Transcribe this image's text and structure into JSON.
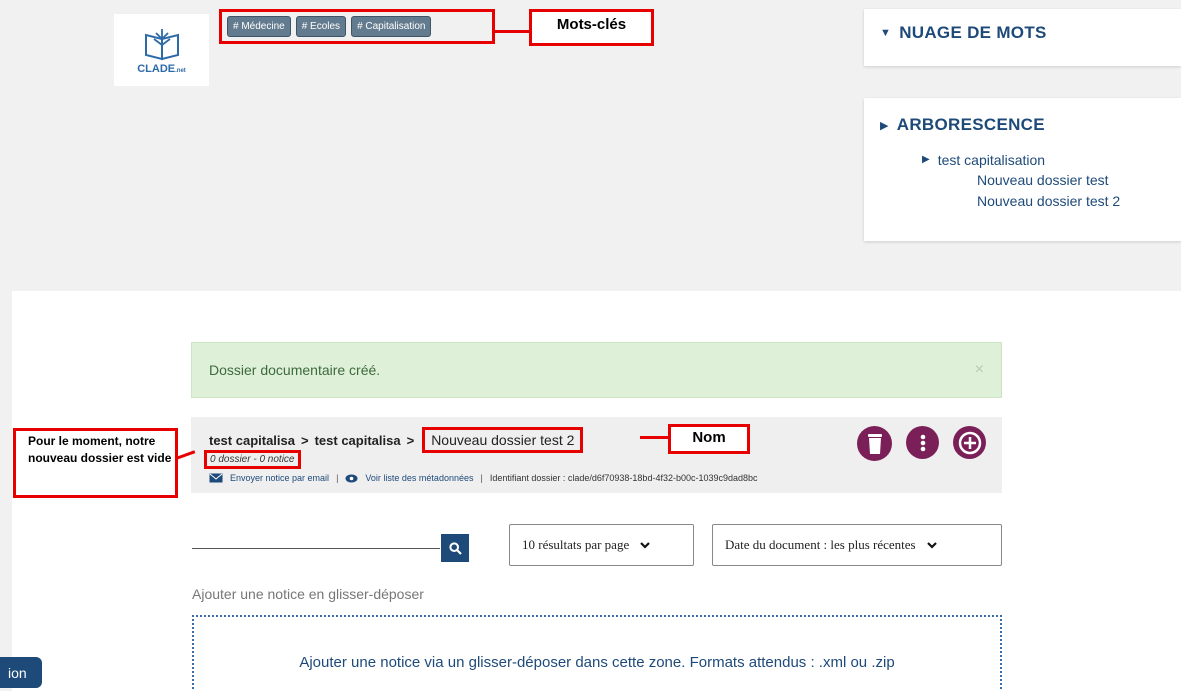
{
  "logo": {
    "name": "CLADE",
    "suffix": ".net"
  },
  "keywords": {
    "tags": [
      "# Médecine",
      "# Ecoles",
      "# Capitalisation"
    ],
    "annotation": "Mots-clés"
  },
  "word_cloud": {
    "title": "NUAGE DE MOTS"
  },
  "tree_panel": {
    "title": "ARBORESCENCE",
    "root": "test capitalisation",
    "children": [
      "Nouveau dossier test",
      "Nouveau dossier test 2"
    ]
  },
  "alert": {
    "message": "Dossier documentaire créé.",
    "close": "×"
  },
  "breadcrumb": {
    "items": [
      "test capitalisa",
      "test capitalisa"
    ],
    "separator": ">",
    "current": "Nouveau dossier test 2"
  },
  "folder": {
    "counts": "0 dossier - 0 notice",
    "email_link": "Envoyer notice par email",
    "metadata_link": "Voir liste des métadonnées",
    "identifier": "Identifiant dossier : clade/d6f70938-18bd-4f32-b00c-1039c9dad8bc",
    "pipe": "|"
  },
  "annotations": {
    "name": "Nom",
    "empty_note": "Pour le moment, notre nouveau dossier est vide"
  },
  "search": {
    "placeholder": ""
  },
  "selects": {
    "per_page": "10 résultats par page",
    "sort": "Date du document : les plus récentes"
  },
  "dropzone": {
    "label": "Ajouter une notice en glisser-déposer",
    "text": "Ajouter une notice via un glisser-déposer dans cette zone. Formats attendus : .xml ou .zip"
  },
  "bottom_tab": {
    "label": "ion"
  },
  "colors": {
    "accent": "#1e4a7a",
    "annotation_red": "#e60000",
    "action_purple": "#7a1f57",
    "tag_bg": "#637b8e",
    "alert_bg": "#dff0d8"
  }
}
